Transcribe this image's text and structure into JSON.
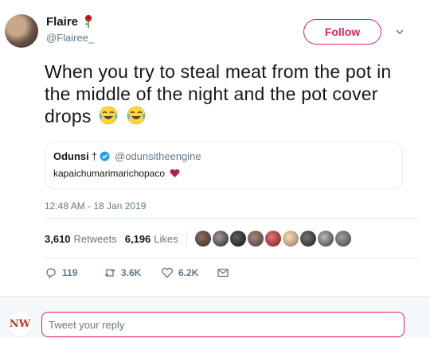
{
  "author": {
    "display_name": "Flaire",
    "handle": "@Flairee_",
    "name_emoji": "rose-icon"
  },
  "follow_label": "Follow",
  "tweet": {
    "text": "When you try to steal meat from the pot in the middle of the night and the pot cover drops",
    "emojis": [
      "tears-of-joy-icon",
      "tears-of-joy-icon"
    ]
  },
  "quote": {
    "name": "Odunsi",
    "name_symbol": "†",
    "handle": "@odunsitheengine",
    "text": "kapaichumarimarichopaco"
  },
  "timestamp": "12:48 AM - 18 Jan 2019",
  "stats": {
    "retweets_count": "3,610",
    "retweets_label": "Retweets",
    "likes_count": "6,196",
    "likes_label": "Likes",
    "liker_count": 10
  },
  "actions": {
    "replies": "119",
    "retweets": "3.6K",
    "likes": "6.2K"
  },
  "reply": {
    "avatar_text": "NW",
    "placeholder": "Tweet your reply"
  },
  "colors": {
    "accent": "#e0245e",
    "text": "#14171a",
    "muted": "#657786",
    "verified": "#1da1f2"
  }
}
